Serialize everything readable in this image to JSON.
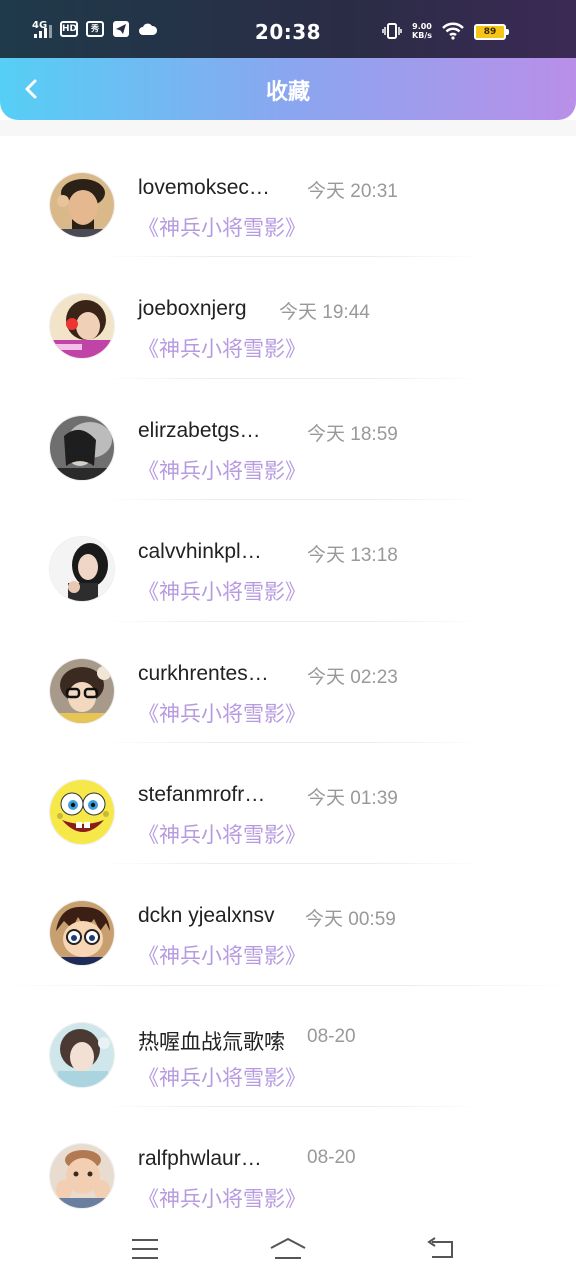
{
  "status_bar": {
    "network": "4G",
    "hd": "HD",
    "time": "20:38",
    "speed_value": "9.00",
    "speed_unit": "KB/s",
    "battery": "89"
  },
  "header": {
    "title": "收藏"
  },
  "items": [
    {
      "name": "lovemoksec…",
      "time": "今天 20:31",
      "title": "《神兵小将雪影》",
      "avatar": "avatar-photo-man"
    },
    {
      "name": "joeboxnjerg",
      "time": "今天 19:44",
      "title": "《神兵小将雪影》",
      "avatar": "avatar-photo-girl"
    },
    {
      "name": "elirzabetgs…",
      "time": "今天 18:59",
      "title": "《神兵小将雪影》",
      "avatar": "avatar-photo-dark"
    },
    {
      "name": "calvvhinkpl…",
      "time": "今天 13:18",
      "title": "《神兵小将雪影》",
      "avatar": "avatar-photo-woman"
    },
    {
      "name": "curkhrentes…",
      "time": "今天 02:23",
      "title": "《神兵小将雪影》",
      "avatar": "avatar-photo-glasses"
    },
    {
      "name": "stefanmrofr…",
      "time": "今天 01:39",
      "title": "《神兵小将雪影》",
      "avatar": "avatar-spongebob"
    },
    {
      "name": "dckn yjealxnsv",
      "time": "今天 00:59",
      "title": "《神兵小将雪影》",
      "avatar": "avatar-anime-boy"
    },
    {
      "name": "热喔血战氚歌嗦",
      "time": "08-20",
      "title": "《神兵小将雪影》",
      "avatar": "avatar-photo-girl-blue"
    },
    {
      "name": "ralfphwlaur…",
      "time": "08-20",
      "title": "《神兵小将雪影》",
      "avatar": "avatar-photo-child"
    }
  ],
  "colors": {
    "accent_purple": "#b79be0",
    "header_start": "#55cff5",
    "header_end": "#b98fe8"
  },
  "navbar": {
    "menu_icon": "menu-icon",
    "home_icon": "home-icon",
    "back_icon": "back-icon"
  }
}
